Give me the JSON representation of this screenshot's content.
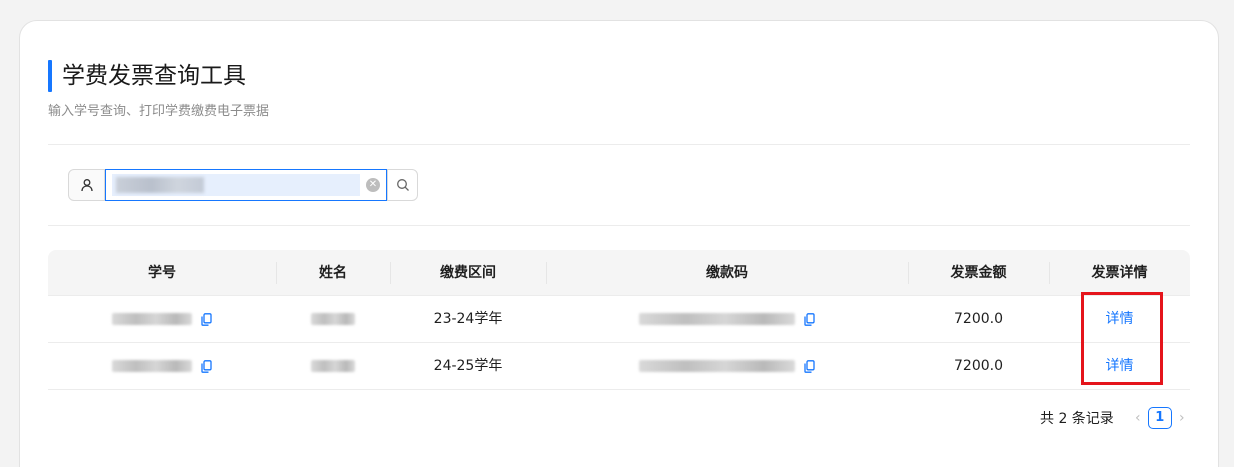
{
  "header": {
    "title": "学费发票查询工具",
    "subtitle": "输入学号查询、打印学费缴费电子票据"
  },
  "search": {
    "value": "",
    "user_icon": "user-icon",
    "clear_icon": "close-circle-icon",
    "search_icon": "search-icon"
  },
  "table": {
    "columns": [
      "学号",
      "姓名",
      "缴费区间",
      "缴款码",
      "发票金额",
      "发票详情"
    ],
    "rows": [
      {
        "period": "23-24学年",
        "amount": "7200.0",
        "detail": "详情"
      },
      {
        "period": "24-25学年",
        "amount": "7200.0",
        "detail": "详情"
      }
    ]
  },
  "pagination": {
    "total": "共 2 条记录",
    "current": "1"
  },
  "colors": {
    "accent": "#1677ff",
    "highlight": "#e5141b"
  }
}
